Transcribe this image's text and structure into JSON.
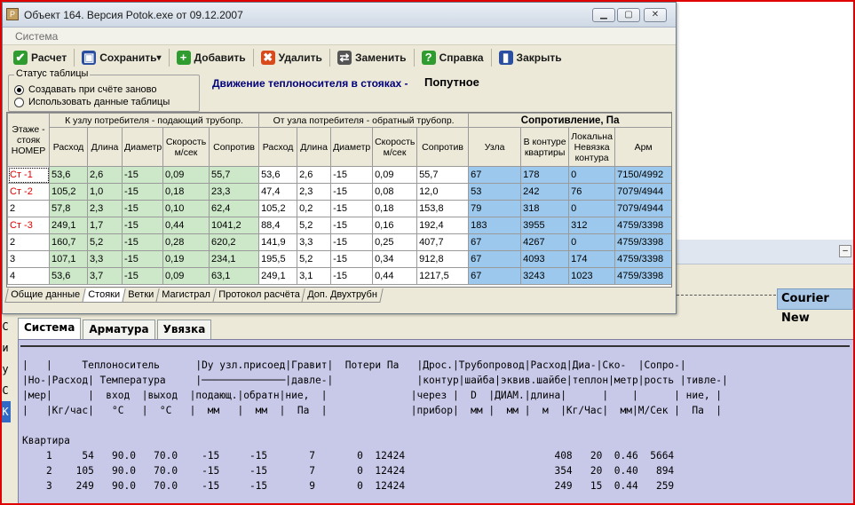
{
  "window": {
    "title": "Объект 164. Версия Potok.exe от 09.12.2007",
    "menu": [
      "Система"
    ]
  },
  "toolbar": [
    {
      "label": "Расчет",
      "icon": "check-icon",
      "color": "#2e9c2e"
    },
    {
      "label": "Сохранить",
      "icon": "save-icon",
      "color": "#2a4fa0",
      "dropdown": true
    },
    {
      "label": "Добавить",
      "icon": "plus-icon",
      "color": "#2e9c2e"
    },
    {
      "label": "Удалить",
      "icon": "delete-icon",
      "color": "#d84a1b"
    },
    {
      "label": "Заменить",
      "icon": "replace-icon",
      "color": "#555555"
    },
    {
      "label": "Справка",
      "icon": "help-icon",
      "color": "#2e9c2e"
    },
    {
      "label": "Закрыть",
      "icon": "close-door-icon",
      "color": "#2a4fa0"
    }
  ],
  "status": {
    "legend": "Статус таблицы",
    "options": [
      {
        "label": "Создавать при счёте заново",
        "checked": true
      },
      {
        "label": "Использовать данные таблицы",
        "checked": false
      }
    ]
  },
  "flow": {
    "title": "Движение теплоносителя  в стояках  -",
    "mode": "Попутное"
  },
  "grid": {
    "group_headers": {
      "supply": "К узлу  потребителя - подающий трубопр.",
      "return": "От узла потребителя - обратный трубопр.",
      "resistance": "Сопротивление, Па"
    },
    "columns": {
      "floor": "Этаже - стояк НОМЕР",
      "flow": "Расход",
      "length": "Длина",
      "diameter": "Диаметр",
      "speed": "Скорость м/сек",
      "resist": "Сопротив",
      "node": "Узла",
      "in_loop": "В контуре квартиры",
      "local_mismatch": "Локальна Невязка контура",
      "fittings": "Арм"
    },
    "rows": [
      {
        "id": "Ст -1",
        "red": true,
        "s": [
          "53,6",
          "2,6",
          "-15",
          "0,09",
          "55,7"
        ],
        "r": [
          "53,6",
          "2,6",
          "-15",
          "0,09",
          "55,7"
        ],
        "z": [
          "67",
          "178",
          "0",
          "7150/4992"
        ]
      },
      {
        "id": "Ст -2",
        "red": true,
        "s": [
          "105,2",
          "1,0",
          "-15",
          "0,18",
          "23,3"
        ],
        "r": [
          "47,4",
          "2,3",
          "-15",
          "0,08",
          "12,0"
        ],
        "z": [
          "53",
          "242",
          "76",
          "7079/4944"
        ]
      },
      {
        "id": "2",
        "red": false,
        "s": [
          "57,8",
          "2,3",
          "-15",
          "0,10",
          "62,4"
        ],
        "r": [
          "105,2",
          "0,2",
          "-15",
          "0,18",
          "153,8"
        ],
        "z": [
          "79",
          "318",
          "0",
          "7079/4944"
        ]
      },
      {
        "id": "Ст -3",
        "red": true,
        "s": [
          "249,1",
          "1,7",
          "-15",
          "0,44",
          "1041,2"
        ],
        "r": [
          "88,4",
          "5,2",
          "-15",
          "0,16",
          "192,4"
        ],
        "z": [
          "183",
          "3955",
          "312",
          "4759/3398"
        ]
      },
      {
        "id": "2",
        "red": false,
        "s": [
          "160,7",
          "5,2",
          "-15",
          "0,28",
          "620,2"
        ],
        "r": [
          "141,9",
          "3,3",
          "-15",
          "0,25",
          "407,7"
        ],
        "z": [
          "67",
          "4267",
          "0",
          "4759/3398"
        ]
      },
      {
        "id": "3",
        "red": false,
        "s": [
          "107,1",
          "3,3",
          "-15",
          "0,19",
          "234,1"
        ],
        "r": [
          "195,5",
          "5,2",
          "-15",
          "0,34",
          "912,8"
        ],
        "z": [
          "67",
          "4093",
          "174",
          "4759/3398"
        ]
      },
      {
        "id": "4",
        "red": false,
        "s": [
          "53,6",
          "3,7",
          "-15",
          "0,09",
          "63,1"
        ],
        "r": [
          "249,1",
          "3,1",
          "-15",
          "0,44",
          "1217,5"
        ],
        "z": [
          "67",
          "3243",
          "1023",
          "4759/3398"
        ]
      }
    ]
  },
  "sheet_tabs": [
    "Общие данные",
    "Стояки",
    "Ветки",
    "Магистрал",
    "Протокол расчёта",
    "Доп. Двухтрубн"
  ],
  "sheet_tab_active": 1,
  "background": {
    "font_indicator": "Courier New",
    "tabs": [
      "Система",
      "Арматура",
      "Увязка"
    ],
    "left_glyphs": [
      "С",
      "и",
      "у",
      "С",
      "К"
    ],
    "report_lines": [
      "|   |     Теплоноситель      |Dy узл.присоед|Гравит|  Потери Па   |Дрос.|Трубопровод|Расход|Диа-|Ско-  |Сопро-|",
      "|Но-|Расход| Температура     |──────────────|давле-|              |контур|шайба|эквив.шайбе|теплон|метр|рость |тивле-|",
      "|мер|      |  вход  |выход  |подающ.|обратн|ние,  |              |через |  D  |ДИАМ.|длина|      |    |      | ние, |",
      "|   |Кг/час|   °C   |  °C   |  мм   |  мм  |  Па  |              |прибор|  мм |  мм |  м  |Кг/Час|  мм|M/Сек |  Па  |",
      "",
      "Квартира",
      "    1     54   90.0   70.0    -15     -15       7       0  12424                         408   20  0.46  5664",
      "    2    105   90.0   70.0    -15     -15       7       0  12424                         354   20  0.40   894",
      "    3    249   90.0   70.0    -15     -15       9       0  12424                         249   15  0.44   259"
    ]
  }
}
